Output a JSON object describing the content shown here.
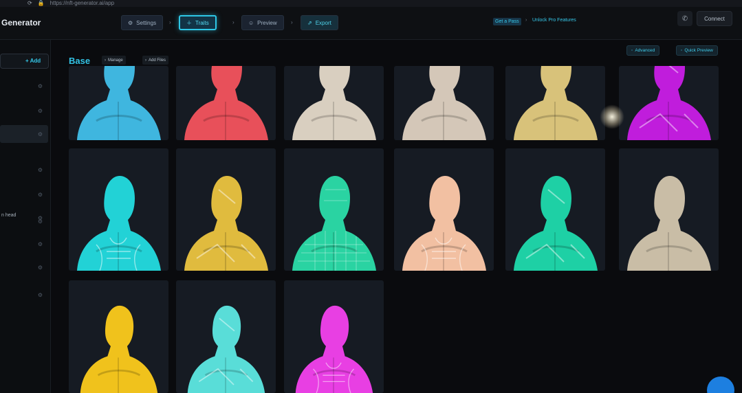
{
  "browser": {
    "url": "https://nft-generator.ai/app"
  },
  "header": {
    "brand": "Generator",
    "steps": [
      {
        "label": "Settings",
        "icon": "gear-icon"
      },
      {
        "label": "Traits",
        "icon": "plus-icon"
      },
      {
        "label": "Preview",
        "icon": "person-icon"
      },
      {
        "label": "Export",
        "icon": "export-icon"
      }
    ],
    "crumbs": [
      "Get a Pass",
      "Unlock Pro Features"
    ],
    "connect_label": "Connect"
  },
  "sidebar": {
    "add_label": "+ Add",
    "items": [
      {
        "label": ""
      },
      {
        "label": ""
      },
      {
        "label": ""
      },
      {
        "label": ""
      },
      {
        "label": ""
      },
      {
        "label": ""
      },
      {
        "label": ""
      },
      {
        "label": "n head"
      },
      {
        "label": ""
      },
      {
        "label": ""
      },
      {
        "label": ""
      },
      {
        "label": ""
      }
    ]
  },
  "main": {
    "section_title": "Base",
    "chips": [
      "Manage",
      "Add Files"
    ],
    "advanced_label": "Advanced",
    "quick_preview_label": "Quick Preview",
    "trait_colors": [
      {
        "body": "#3fb6df",
        "style": "plain"
      },
      {
        "body": "#e8505a",
        "style": "plain"
      },
      {
        "body": "#d9cfc0",
        "style": "plain"
      },
      {
        "body": "#d4c7b8",
        "style": "plain"
      },
      {
        "body": "#d8c27a",
        "style": "plain"
      },
      {
        "body": "#c01ddc",
        "style": "pattern"
      },
      {
        "body": "#22d2d6",
        "style": "muscle"
      },
      {
        "body": "#e0bb3e",
        "style": "pattern"
      },
      {
        "body": "#2ad3a2",
        "style": "grid"
      },
      {
        "body": "#f2c0a2",
        "style": "muscle"
      },
      {
        "body": "#1ed0a5",
        "style": "pattern"
      },
      {
        "body": "#c9bda6",
        "style": "plain"
      },
      {
        "body": "#f0c21c",
        "style": "plain"
      },
      {
        "body": "#59ddd8",
        "style": "pattern"
      },
      {
        "body": "#e83fe3",
        "style": "muscle"
      }
    ]
  }
}
